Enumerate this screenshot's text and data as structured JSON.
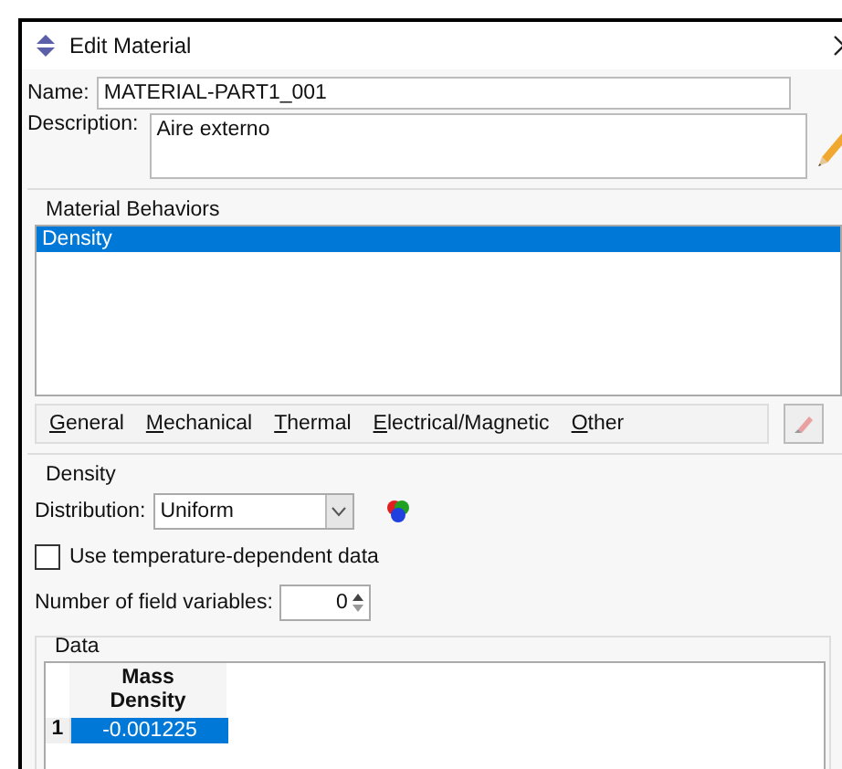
{
  "window": {
    "title": "Edit Material"
  },
  "name": {
    "label": "Name:",
    "value": "MATERIAL-PART1_001"
  },
  "description": {
    "label": "Description:",
    "value": "Aire externo"
  },
  "behaviors": {
    "title": "Material Behaviors",
    "items": [
      {
        "label": "Density",
        "selected": true
      }
    ]
  },
  "menu": [
    {
      "label": "General"
    },
    {
      "label": "Mechanical"
    },
    {
      "label": "Thermal"
    },
    {
      "label": "Electrical/Magnetic"
    },
    {
      "label": "Other"
    }
  ],
  "density": {
    "title": "Density",
    "distribution_label": "Distribution:",
    "distribution": "Uniform",
    "temperature_dependent": {
      "label": "Use temperature-dependent data",
      "checked": false
    },
    "field_variables_label": "Number of field variables:",
    "field_variables": "0",
    "data": {
      "title": "Data",
      "columns": [
        "Mass Density"
      ],
      "rows": [
        {
          "index": "1",
          "cells": [
            {
              "value": "-0.001225",
              "selected": true
            }
          ]
        }
      ]
    }
  }
}
